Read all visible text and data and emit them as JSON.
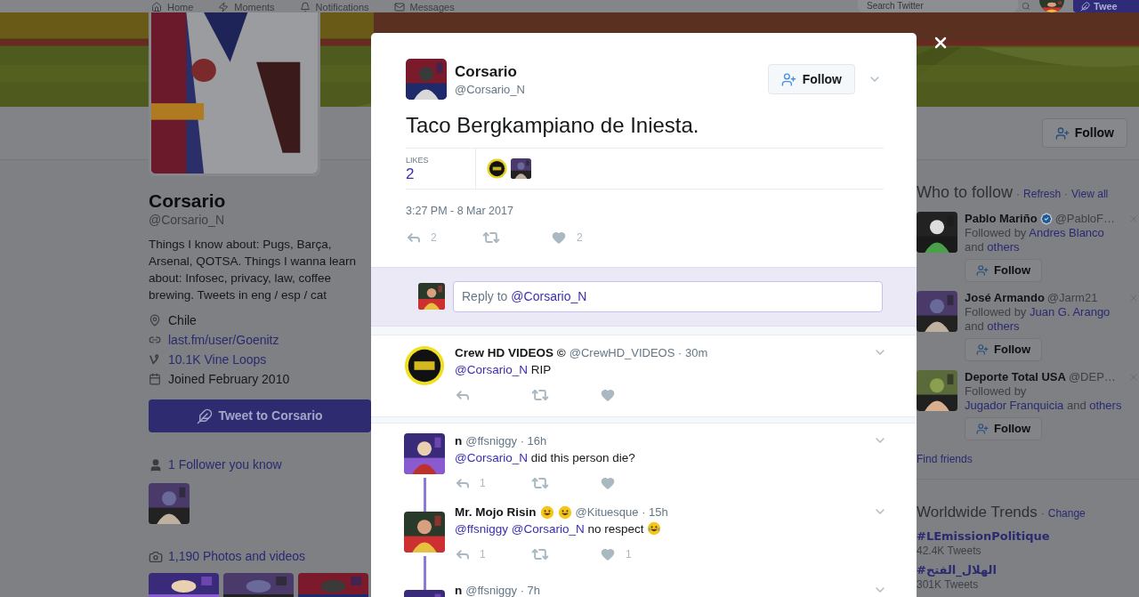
{
  "nav": {
    "items": [
      {
        "label": "Home",
        "selected": false
      },
      {
        "label": "Moments",
        "selected": false
      },
      {
        "label": "Notifications",
        "selected": false
      },
      {
        "label": "Messages",
        "selected": false
      }
    ],
    "search": {
      "placeholder": "Search Twitter"
    },
    "tweet_button": "Twee"
  },
  "profile_bar": {
    "follow": "Follow"
  },
  "profile": {
    "name": "Corsario",
    "handle": "@Corsario_N",
    "bio": "Things I know about: Pugs, Barça, Arsenal, QOTSA. Things I wanna learn about: Infosec, privacy, law, coffee brewing. Tweets in eng / esp / cat",
    "details": [
      {
        "kind": "location",
        "text": "Chile"
      },
      {
        "kind": "link",
        "text": "last.fm/user/Goenitz"
      },
      {
        "kind": "vine",
        "text": "10.1K Vine Loops"
      },
      {
        "kind": "joined",
        "text": "Joined February 2010"
      }
    ],
    "tweet_to": "Tweet to Corsario",
    "followers_you_know": "1 Follower you know",
    "photos": "1,190 Photos and videos"
  },
  "modal": {
    "author": {
      "name": "Corsario",
      "handle": "@Corsario_N"
    },
    "follow": "Follow",
    "text": "Taco Bergkampiano de Iniesta.",
    "likes_label": "LIKES",
    "likes_count": "2",
    "timestamp": "3:27 PM - 8 Mar 2017",
    "reply_count": "2",
    "like_count": "2",
    "composer": {
      "prompt": "Reply to",
      "mention": "@Corsario_N"
    },
    "replies": [
      {
        "name": "Crew HD VIDEOS ©",
        "name_emoji": false,
        "meta": "@CrewHD_VIDEOS · 30m",
        "segments": [
          {
            "kind": "mention",
            "text": "@Corsario_N"
          },
          {
            "kind": "plain",
            "text": "RIP"
          }
        ],
        "text_emoji": false,
        "thread_above": false,
        "thread_below": false,
        "gap_after": true
      },
      {
        "name": "n",
        "name_emoji": false,
        "meta": "@ffsniggy · 16h",
        "segments": [
          {
            "kind": "mention",
            "text": "@Corsario_N"
          },
          {
            "kind": "plain",
            "text": "did this person die?"
          }
        ],
        "text_emoji": false,
        "reply_count": "1",
        "thread_above": false,
        "thread_below": true,
        "gap_after": false
      },
      {
        "name": "Mr. Mojo Risin",
        "name_emoji": true,
        "meta": "@Kituesque · 15h",
        "segments": [
          {
            "kind": "mention",
            "text": "@ffsniggy"
          },
          {
            "kind": "mention",
            "text": "@Corsario_N"
          },
          {
            "kind": "plain",
            "text": "no respect"
          }
        ],
        "text_emoji": true,
        "reply_count": "1",
        "like_count": "1",
        "thread_above": true,
        "thread_below": true,
        "gap_after": false
      },
      {
        "name": "n",
        "name_emoji": false,
        "meta": "@ffsniggy · 7h",
        "text_emoji": false,
        "thread_above": true,
        "thread_below": false,
        "gap_after": false
      }
    ]
  },
  "who_to_follow": {
    "title": "Who to follow",
    "separator": "·",
    "refresh": "Refresh",
    "view_all": "View all",
    "items": [
      {
        "name": "Pablo Mariño",
        "verified": true,
        "handle": "@PabloF…",
        "prefix": "Followed by",
        "followers": "Andres Blanco",
        "joiner": "and",
        "others": "others",
        "follow": "Follow"
      },
      {
        "name": "José Armando",
        "verified": false,
        "handle": "@Jarm21",
        "prefix": "Followed by",
        "followers": "Juan G. Arango",
        "joiner": "and",
        "others": "others",
        "follow": "Follow"
      },
      {
        "name": "Deporte Total USA",
        "verified": false,
        "handle": "@DEP…",
        "prefix": "Followed by",
        "followers": "Jugador Franquicia",
        "joiner": "and",
        "others": "others",
        "follow": "Follow"
      }
    ],
    "find_friends": "Find friends"
  },
  "trends": {
    "title": "Worldwide Trends",
    "separator": "·",
    "change": "Change",
    "items": [
      {
        "tag": "#LEmissionPolitique",
        "count": "42.4K Tweets"
      },
      {
        "tag": "#الهلال_الفتح",
        "count": "301K Tweets"
      }
    ]
  }
}
